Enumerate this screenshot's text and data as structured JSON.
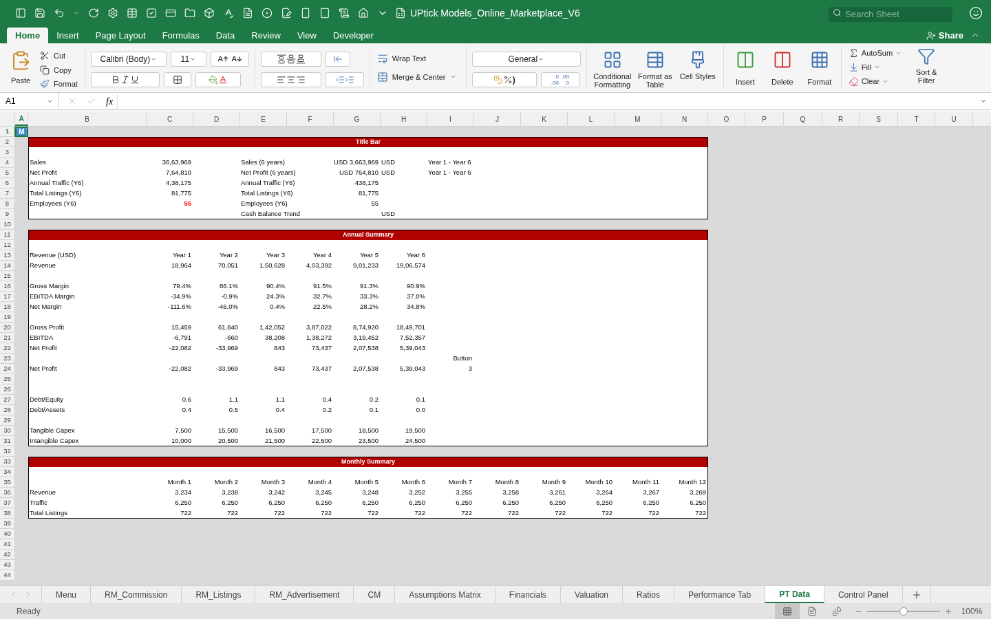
{
  "title_bar": {
    "document_title": "UPtick Models_Online_Marketplace_V6",
    "search_placeholder": "Search Sheet"
  },
  "ribbon": {
    "tabs": [
      {
        "label": "Home",
        "selected": true
      },
      {
        "label": "Insert",
        "selected": false
      },
      {
        "label": "Page Layout",
        "selected": false
      },
      {
        "label": "Formulas",
        "selected": false
      },
      {
        "label": "Data",
        "selected": false
      },
      {
        "label": "Review",
        "selected": false
      },
      {
        "label": "View",
        "selected": false
      },
      {
        "label": "Developer",
        "selected": false
      }
    ],
    "share": "Share",
    "clipboard": {
      "paste": "Paste",
      "cut": "Cut",
      "copy": "Copy",
      "format": "Format"
    },
    "font": {
      "name": "Calibri (Body)",
      "size": "11"
    },
    "alignment": {
      "wrap": "Wrap Text",
      "merge": "Merge & Center"
    },
    "number": {
      "format": "General",
      "comma": ")",
      "increase_decimal": [
        ".0",
        ".00"
      ],
      "decrease_decimal": [
        ".00",
        ".0"
      ]
    },
    "styles": [
      "Conditional Formatting",
      "Format as Table",
      "Cell Styles"
    ],
    "cells": [
      "Insert",
      "Delete",
      "Format"
    ],
    "editing": {
      "autosum": "AutoSum",
      "fill": "Fill",
      "clear": "Clear",
      "sort": "Sort & Filter"
    }
  },
  "formula_bar": {
    "name_box": "A1",
    "fx": "fx"
  },
  "sheet": {
    "columns": [
      {
        "label": "A",
        "selected": true
      },
      {
        "label": "B",
        "selected": false
      },
      {
        "label": "C",
        "selected": false
      },
      {
        "label": "D",
        "selected": false
      },
      {
        "label": "E",
        "selected": false
      },
      {
        "label": "F",
        "selected": false
      },
      {
        "label": "G",
        "selected": false
      },
      {
        "label": "H",
        "selected": false
      },
      {
        "label": "I",
        "selected": false
      },
      {
        "label": "J",
        "selected": false
      },
      {
        "label": "K",
        "selected": false
      },
      {
        "label": "L",
        "selected": false
      },
      {
        "label": "M",
        "selected": false
      },
      {
        "label": "N",
        "selected": false
      },
      {
        "label": "O",
        "selected": false
      },
      {
        "label": "P",
        "selected": false
      },
      {
        "label": "Q",
        "selected": false
      },
      {
        "label": "R",
        "selected": false
      },
      {
        "label": "S",
        "selected": false
      },
      {
        "label": "T",
        "selected": false
      },
      {
        "label": "U",
        "selected": false
      }
    ],
    "rows": [
      {
        "number": "1",
        "selected": true,
        "kind": "gap",
        "cells": [
          {
            "text": "M",
            "kind": "shape"
          }
        ]
      },
      {
        "number": "2",
        "selected": false,
        "kind": "bar",
        "title": "Title Bar"
      },
      {
        "number": "3",
        "selected": false,
        "kind": "body",
        "cells": []
      },
      {
        "number": "4",
        "selected": false,
        "kind": "body",
        "cells": [
          null,
          "Sales",
          "36,63,969",
          null,
          {
            "text": "Sales (6 years)",
            "kind": "label"
          },
          null,
          "USD 3,663,969",
          {
            "text": "USD",
            "kind": "label"
          },
          {
            "text": "Year 1 - Year 6",
            "kind": "label"
          }
        ]
      },
      {
        "number": "5",
        "selected": false,
        "kind": "body",
        "cells": [
          null,
          "Net Profit",
          "7,64,810",
          null,
          {
            "text": "Net Profit (6 years)",
            "kind": "label"
          },
          null,
          "USD 764,810",
          {
            "text": "USD",
            "kind": "label"
          },
          {
            "text": "Year 1 - Year 6",
            "kind": "label"
          }
        ]
      },
      {
        "number": "6",
        "selected": false,
        "kind": "body",
        "cells": [
          null,
          "Annual Traffic (Y6)",
          "4,38,175",
          null,
          {
            "text": "Annual Traffic (Y6)",
            "kind": "label"
          },
          null,
          "438,175"
        ]
      },
      {
        "number": "7",
        "selected": false,
        "kind": "body",
        "cells": [
          null,
          "Total Listings (Y6)",
          "81,775",
          null,
          {
            "text": "Total Listings (Y6)",
            "kind": "label"
          },
          null,
          "81,775"
        ]
      },
      {
        "number": "8",
        "selected": false,
        "kind": "body",
        "cells": [
          null,
          "Employees (Y6)",
          {
            "text": "55",
            "color": "#ff0000"
          },
          null,
          {
            "text": "Employees (Y6)",
            "kind": "label"
          },
          null,
          "55"
        ]
      },
      {
        "number": "9",
        "selected": false,
        "kind": "end",
        "cells": [
          null,
          null,
          null,
          null,
          {
            "text": "Cash Balance Trend",
            "kind": "label"
          },
          null,
          null,
          {
            "text": "USD",
            "kind": "label"
          }
        ]
      },
      {
        "number": "10",
        "selected": false,
        "kind": "gap",
        "cells": []
      },
      {
        "number": "11",
        "selected": false,
        "kind": "bar",
        "title": "Annual Summary"
      },
      {
        "number": "12",
        "selected": false,
        "kind": "body",
        "cells": []
      },
      {
        "number": "13",
        "selected": false,
        "kind": "body",
        "cells": [
          null,
          "Revenue (USD)",
          "Year 1",
          "Year 2",
          "Year 3",
          "Year 4",
          "Year 5",
          "Year 6"
        ]
      },
      {
        "number": "14",
        "selected": false,
        "kind": "body",
        "cells": [
          null,
          "Revenue",
          "18,964",
          "70,051",
          "1,50,628",
          "4,03,392",
          "9,01,233",
          "19,06,574"
        ]
      },
      {
        "number": "15",
        "selected": false,
        "kind": "body",
        "cells": []
      },
      {
        "number": "16",
        "selected": false,
        "kind": "body",
        "cells": [
          null,
          "Gross Margin",
          "79.4%",
          "86.1%",
          "90.4%",
          "91.5%",
          "91.3%",
          "90.9%"
        ]
      },
      {
        "number": "17",
        "selected": false,
        "kind": "body",
        "cells": [
          null,
          "EBITDA Margin",
          "-34.9%",
          "-0.9%",
          "24.3%",
          "32.7%",
          "33.3%",
          "37.0%"
        ]
      },
      {
        "number": "18",
        "selected": false,
        "kind": "body",
        "cells": [
          null,
          "Net Margin",
          "-111.6%",
          "-46.0%",
          "0.4%",
          "22.5%",
          "28.2%",
          "34.8%"
        ]
      },
      {
        "number": "19",
        "selected": false,
        "kind": "body",
        "cells": []
      },
      {
        "number": "20",
        "selected": false,
        "kind": "body",
        "cells": [
          null,
          "Gross Profit",
          "15,459",
          "61,840",
          "1,42,052",
          "3,87,022",
          "8,74,920",
          "18,49,701"
        ]
      },
      {
        "number": "21",
        "selected": false,
        "kind": "body",
        "cells": [
          null,
          "EBITDA",
          "-6,791",
          "-660",
          "38,208",
          "1,38,272",
          "3,19,452",
          "7,52,357"
        ]
      },
      {
        "number": "22",
        "selected": false,
        "kind": "body",
        "cells": [
          null,
          "Net Profit",
          "-22,082",
          "-33,969",
          "843",
          "73,437",
          "2,07,538",
          "5,39,043"
        ]
      },
      {
        "number": "23",
        "selected": false,
        "kind": "body",
        "cells": [
          null,
          null,
          null,
          null,
          null,
          null,
          null,
          null,
          "Button"
        ]
      },
      {
        "number": "24",
        "selected": false,
        "kind": "body",
        "cells": [
          null,
          "Net Profit",
          "-22,082",
          "-33,969",
          "843",
          "73,437",
          "2,07,538",
          "5,39,043",
          "3"
        ]
      },
      {
        "number": "25",
        "selected": false,
        "kind": "body",
        "cells": []
      },
      {
        "number": "26",
        "selected": false,
        "kind": "body",
        "cells": []
      },
      {
        "number": "27",
        "selected": false,
        "kind": "body",
        "cells": [
          null,
          "Debt/Equity",
          "0.6",
          "1.1",
          "1.1",
          "0.4",
          "0.2",
          "0.1"
        ]
      },
      {
        "number": "28",
        "selected": false,
        "kind": "body",
        "cells": [
          null,
          "Debt/Assets",
          "0.4",
          "0.5",
          "0.4",
          "0.2",
          "0.1",
          "0.0"
        ]
      },
      {
        "number": "29",
        "selected": false,
        "kind": "body",
        "cells": []
      },
      {
        "number": "30",
        "selected": false,
        "kind": "body",
        "cells": [
          null,
          "Tangible Capex",
          "7,500",
          "15,500",
          "16,500",
          "17,500",
          "18,500",
          "19,500"
        ]
      },
      {
        "number": "31",
        "selected": false,
        "kind": "end",
        "cells": [
          null,
          "Intangible Capex",
          "10,000",
          "20,500",
          "21,500",
          "22,500",
          "23,500",
          "24,500"
        ]
      },
      {
        "number": "32",
        "selected": false,
        "kind": "gap",
        "cells": []
      },
      {
        "number": "33",
        "selected": false,
        "kind": "bar",
        "title": "Monthly Summary"
      },
      {
        "number": "34",
        "selected": false,
        "kind": "body",
        "cells": []
      },
      {
        "number": "35",
        "selected": false,
        "kind": "body",
        "cells": [
          null,
          null,
          "Month 1",
          "Month 2",
          "Month 3",
          "Month 4",
          "Month 5",
          "Month 6",
          "Month 7",
          "Month 8",
          "Month 9",
          "Month 10",
          "Month 11",
          "Month 12"
        ]
      },
      {
        "number": "36",
        "selected": false,
        "kind": "body",
        "cells": [
          null,
          "Revenue",
          "3,234",
          "3,238",
          "3,242",
          "3,245",
          "3,248",
          "3,252",
          "3,255",
          "3,258",
          "3,261",
          "3,264",
          "3,267",
          "3,269"
        ]
      },
      {
        "number": "37",
        "selected": false,
        "kind": "body",
        "cells": [
          null,
          "Traffic",
          "6,250",
          "6,250",
          "6,250",
          "6,250",
          "6,250",
          "6,250",
          "6,250",
          "6,250",
          "6,250",
          "6,250",
          "6,250",
          "6,250"
        ]
      },
      {
        "number": "38",
        "selected": false,
        "kind": "end",
        "cells": [
          null,
          "Total Listings",
          "722",
          "722",
          "722",
          "722",
          "722",
          "722",
          "722",
          "722",
          "722",
          "722",
          "722",
          "722"
        ]
      },
      {
        "number": "39",
        "selected": false,
        "kind": "gap",
        "cells": []
      },
      {
        "number": "40",
        "selected": false,
        "kind": "gap",
        "cells": []
      },
      {
        "number": "41",
        "selected": false,
        "kind": "gap",
        "cells": []
      },
      {
        "number": "42",
        "selected": false,
        "kind": "gap",
        "cells": []
      },
      {
        "number": "43",
        "selected": false,
        "kind": "gap",
        "cells": []
      },
      {
        "number": "44",
        "selected": false,
        "kind": "gap",
        "cells": []
      }
    ]
  },
  "sheet_tabs": [
    {
      "label": "Menu",
      "selected": false
    },
    {
      "label": "RM_Commission",
      "selected": false
    },
    {
      "label": "RM_Listings",
      "selected": false
    },
    {
      "label": "RM_Advertisement",
      "selected": false
    },
    {
      "label": "CM",
      "selected": false
    },
    {
      "label": "Assumptions Matrix",
      "selected": false
    },
    {
      "label": "Financials",
      "selected": false
    },
    {
      "label": "Valuation",
      "selected": false
    },
    {
      "label": "Ratios",
      "selected": false
    },
    {
      "label": "Performance Tab",
      "selected": false
    },
    {
      "label": "PT Data",
      "selected": true
    },
    {
      "label": "Control Panel",
      "selected": false
    }
  ],
  "status_bar": {
    "status": "Ready",
    "zoom": {
      "level": 0.5,
      "reading": "100%"
    }
  }
}
